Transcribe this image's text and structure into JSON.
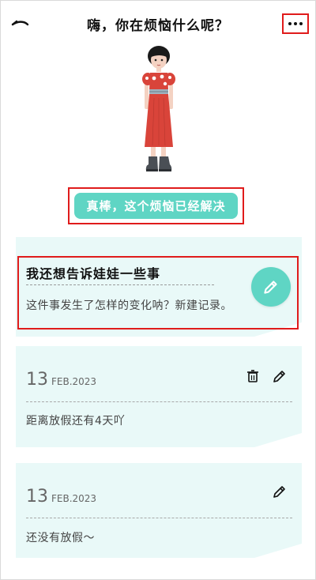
{
  "header": {
    "title": "嗨，你在烦恼什么呢？",
    "back_icon": "back-arrow-icon",
    "more_icon": "more-dots-icon"
  },
  "resolve_button": {
    "label": "真棒，这个烦恼已经解决"
  },
  "new_record_card": {
    "heading": "我还想告诉娃娃一些事",
    "hint": "这件事发生了怎样的变化呐？新建记录。",
    "edit_icon": "pencil-icon"
  },
  "entries": [
    {
      "day": "13",
      "month_year": "FEB.2023",
      "text": "距离放假还有4天吖",
      "icons": [
        "trash-icon",
        "pencil-icon"
      ]
    },
    {
      "day": "13",
      "month_year": "FEB.2023",
      "text": "还没有放假～",
      "icons": [
        "pencil-icon"
      ]
    }
  ],
  "colors": {
    "accent": "#5fd5c4",
    "card_bg": "#e9f9f8",
    "highlight": "#e01b1b",
    "dress": "#d9443a"
  }
}
